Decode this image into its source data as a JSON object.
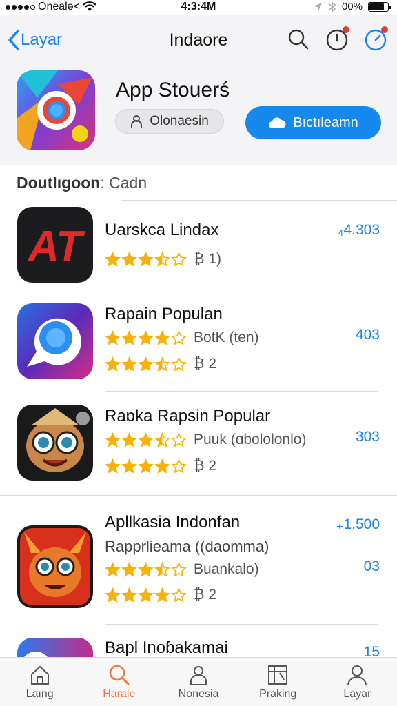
{
  "status_bar": {
    "carrier": "Onealə<",
    "time": "4:3:4M",
    "battery": "00%",
    "battery_level": 0.85
  },
  "nav": {
    "back_label": "Layar",
    "title": "Indaore"
  },
  "hero": {
    "title": "App Stouerś",
    "secondary_button": "Olonaesin",
    "primary_button": "Bıctıleamn"
  },
  "section": {
    "title_bold": "Doutlıgoon",
    "title_rest": ": Cadn"
  },
  "apps": [
    {
      "name": "Uarskca Lindax",
      "price": "₄4.303",
      "ratings": [
        {
          "stars": 3.5,
          "label": "₿ 1)"
        }
      ]
    },
    {
      "name": "Rapain Populan",
      "price": "403",
      "ratings": [
        {
          "stars": 4,
          "label": "BotK (ten)"
        },
        {
          "stars": 3.5,
          "label": "₿ 2"
        }
      ]
    },
    {
      "name": "Raɒka Rapsin Popular",
      "price": "303",
      "ratings": [
        {
          "stars": 3.5,
          "label": "Puuk (ɑbololonlo)"
        },
        {
          "stars": 4,
          "label": "₿ 2"
        }
      ]
    },
    {
      "name": "Apllkasia Indonfan",
      "subtitle": "Rapprlieama ((daomma)",
      "price": "₊1.500",
      "price2": "03",
      "ratings": [
        {
          "stars": 3.5,
          "label": "Buankalo)"
        },
        {
          "stars": 4,
          "label": "₿ 2"
        }
      ]
    },
    {
      "name": "Bapl Inoɓakamai",
      "price": "15"
    }
  ],
  "tabs": [
    {
      "label": "Laıng",
      "icon": "home-icon",
      "active": false
    },
    {
      "label": "Harale",
      "icon": "search-icon",
      "active": true
    },
    {
      "label": "Nonesia",
      "icon": "user-icon",
      "active": false
    },
    {
      "label": "Praking",
      "icon": "charts-icon",
      "active": false
    },
    {
      "label": "Layar",
      "icon": "person-icon",
      "active": false
    }
  ],
  "colors": {
    "accent": "#1788ee",
    "active_tab": "#f07a3c",
    "star": "#f6b20a",
    "badge": "#e53b30"
  }
}
